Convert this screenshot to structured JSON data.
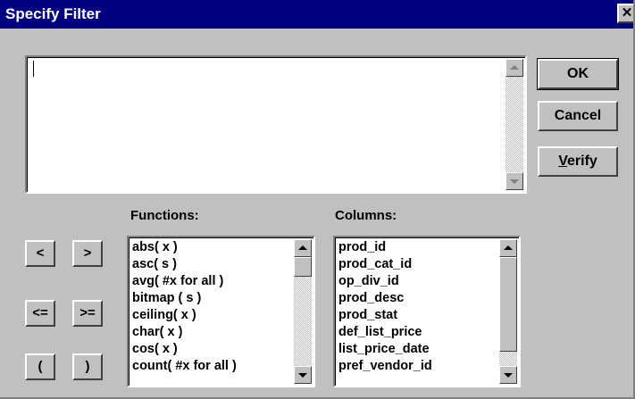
{
  "window": {
    "title": "Specify Filter",
    "close_glyph": "✕",
    "close_icon": "close-icon"
  },
  "editor": {
    "value": ""
  },
  "buttons": {
    "ok": "OK",
    "cancel": "Cancel",
    "verify_accel": "V",
    "verify_rest": "erify"
  },
  "functions": {
    "label": "Functions:",
    "items": [
      "abs( x )",
      "asc( s )",
      "avg( #x for all )",
      "bitmap ( s )",
      "ceiling( x )",
      "char( x )",
      "cos( x )",
      "count( #x for all )"
    ]
  },
  "columns": {
    "label": "Columns:",
    "items": [
      "prod_id",
      "prod_cat_id",
      "op_div_id",
      "prod_desc",
      "prod_stat",
      "def_list_price",
      "list_price_date",
      "pref_vendor_id"
    ]
  },
  "operators": {
    "lt": "<",
    "gt": ">",
    "lte": "<=",
    "gte": ">=",
    "lparen": "(",
    "rparen": ")"
  },
  "colors": {
    "title_bar": "#000080",
    "face": "#c0c0c0"
  }
}
